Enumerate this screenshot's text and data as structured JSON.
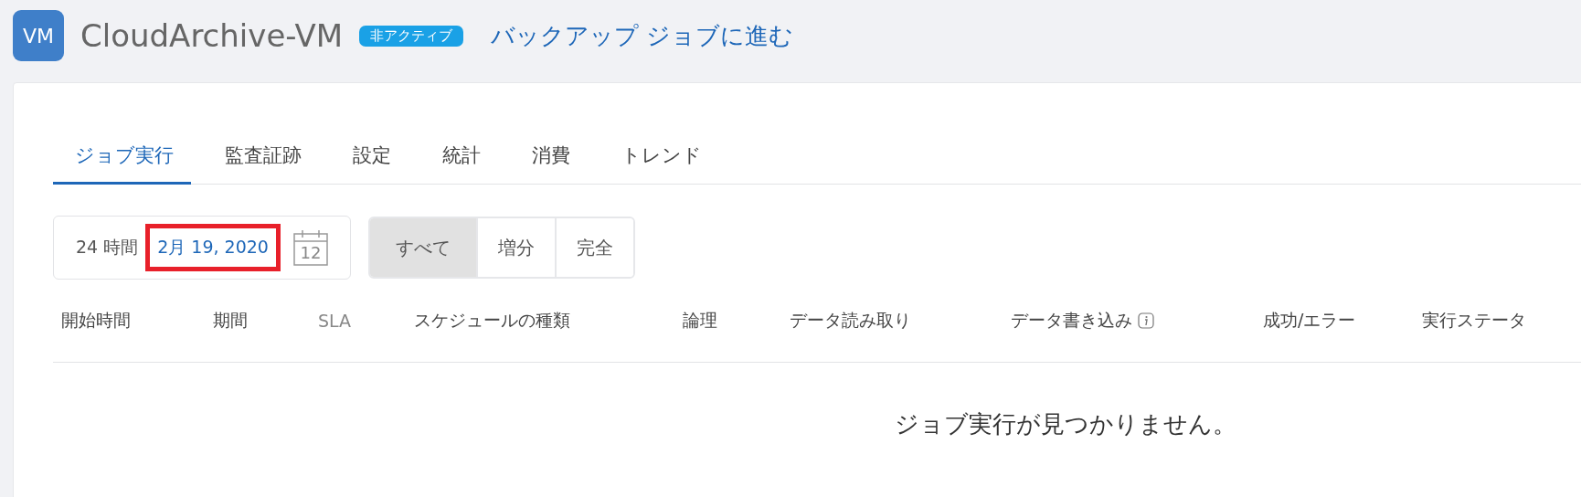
{
  "header": {
    "icon_text": "VM",
    "title": "CloudArchive-VM",
    "status_badge": "非アクティブ",
    "link": "バックアップ ジョブに進む"
  },
  "tabs": [
    {
      "label": "ジョブ実行",
      "selected": true
    },
    {
      "label": "監査証跡",
      "selected": false
    },
    {
      "label": "設定",
      "selected": false
    },
    {
      "label": "統計",
      "selected": false
    },
    {
      "label": "消費",
      "selected": false
    },
    {
      "label": "トレンド",
      "selected": false
    }
  ],
  "date_filter": {
    "range": "24 時間",
    "date": "2月 19, 2020",
    "highlighted": true,
    "calendar_day": "12"
  },
  "type_filter": [
    {
      "label": "すべて",
      "selected": true
    },
    {
      "label": "増分",
      "selected": false
    },
    {
      "label": "完全",
      "selected": false
    }
  ],
  "table": {
    "columns": [
      {
        "label": "開始時間",
        "kind": "plain"
      },
      {
        "label": "期間",
        "kind": "plain"
      },
      {
        "label": "SLA",
        "kind": "light"
      },
      {
        "label": "スケジュールの種類",
        "kind": "plain"
      },
      {
        "label": "論理",
        "kind": "plain"
      },
      {
        "label": "データ読み取り",
        "kind": "plain"
      },
      {
        "label": "データ書き込み",
        "kind": "info"
      },
      {
        "label": "成功/エラー",
        "kind": "plain"
      },
      {
        "label": "実行ステータ",
        "kind": "plain"
      }
    ],
    "empty_message": "ジョブ実行が見つかりません。"
  }
}
